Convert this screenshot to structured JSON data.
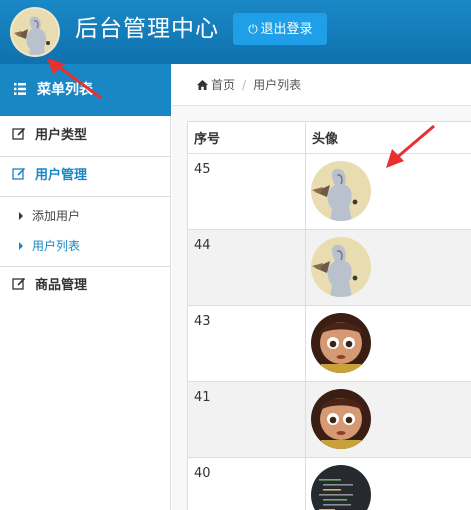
{
  "header": {
    "title": "后台管理中心",
    "logout_label": "退出登录",
    "colors": {
      "bar": "#1783c3",
      "button": "#1e9fe8"
    }
  },
  "sidebar": {
    "menu_title": "菜单列表",
    "items": [
      {
        "label": "用户类型",
        "icon": "edit-icon"
      },
      {
        "label": "用户管理",
        "icon": "edit-icon",
        "active": true
      },
      {
        "label": "商品管理",
        "icon": "edit-icon"
      }
    ],
    "sub_items": [
      {
        "label": "添加用户"
      },
      {
        "label": "用户列表",
        "active": true
      }
    ]
  },
  "breadcrumb": {
    "home": "首页",
    "current": "用户列表"
  },
  "table": {
    "headers": [
      "序号",
      "头像"
    ],
    "rows": [
      {
        "id": "45",
        "avatar": "bird-sketch-avatar"
      },
      {
        "id": "44",
        "avatar": "bird-sketch-avatar"
      },
      {
        "id": "43",
        "avatar": "cartoon-girl-avatar"
      },
      {
        "id": "41",
        "avatar": "cartoon-girl-avatar"
      },
      {
        "id": "40",
        "avatar": "code-screen-avatar"
      }
    ]
  },
  "accent_color": "#1a87c5"
}
